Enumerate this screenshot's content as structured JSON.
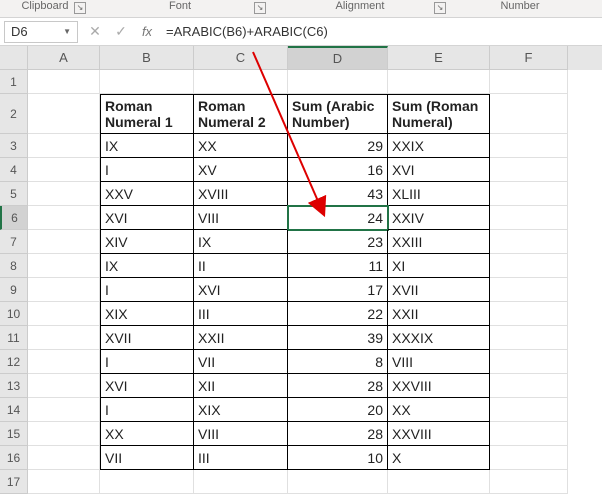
{
  "ribbon": {
    "g1": "Clipboard",
    "g2": "Font",
    "g3": "Alignment",
    "g4": "Number"
  },
  "namebox": "D6",
  "formula": "=ARABIC(B6)+ARABIC(C6)",
  "cols": [
    "A",
    "B",
    "C",
    "D",
    "E",
    "F"
  ],
  "headers": {
    "b": "Roman Numeral 1",
    "c": "Roman Numeral 2",
    "d": "Sum (Arabic Number)",
    "e": "Sum (Roman Numeral)"
  },
  "rows": [
    {
      "n": 3,
      "b": "IX",
      "c": "XX",
      "d": "29",
      "e": "XXIX"
    },
    {
      "n": 4,
      "b": "I",
      "c": "XV",
      "d": "16",
      "e": "XVI"
    },
    {
      "n": 5,
      "b": "XXV",
      "c": "XVIII",
      "d": "43",
      "e": "XLIII"
    },
    {
      "n": 6,
      "b": "XVI",
      "c": "VIII",
      "d": "24",
      "e": "XXIV"
    },
    {
      "n": 7,
      "b": "XIV",
      "c": "IX",
      "d": "23",
      "e": "XXIII"
    },
    {
      "n": 8,
      "b": "IX",
      "c": "II",
      "d": "11",
      "e": "XI"
    },
    {
      "n": 9,
      "b": "I",
      "c": "XVI",
      "d": "17",
      "e": "XVII"
    },
    {
      "n": 10,
      "b": "XIX",
      "c": "III",
      "d": "22",
      "e": "XXII"
    },
    {
      "n": 11,
      "b": "XVII",
      "c": "XXII",
      "d": "39",
      "e": "XXXIX"
    },
    {
      "n": 12,
      "b": "I",
      "c": "VII",
      "d": "8",
      "e": "VIII"
    },
    {
      "n": 13,
      "b": "XVI",
      "c": "XII",
      "d": "28",
      "e": "XXVIII"
    },
    {
      "n": 14,
      "b": "I",
      "c": "XIX",
      "d": "20",
      "e": "XX"
    },
    {
      "n": 15,
      "b": "XX",
      "c": "VIII",
      "d": "28",
      "e": "XXVIII"
    },
    {
      "n": 16,
      "b": "VII",
      "c": "III",
      "d": "10",
      "e": "X"
    }
  ]
}
